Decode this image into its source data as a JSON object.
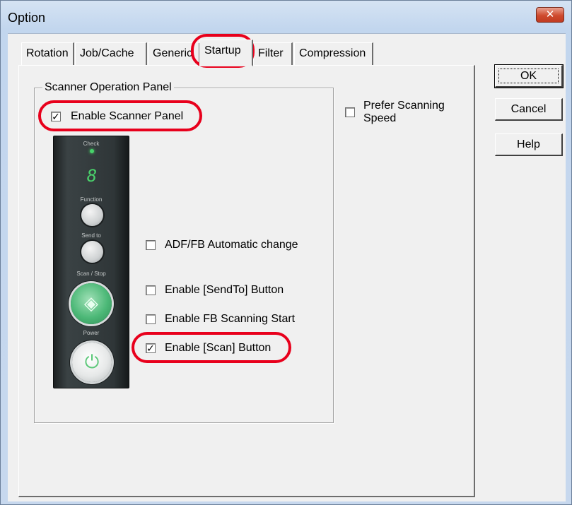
{
  "window": {
    "title": "Option",
    "close_glyph": "✕"
  },
  "tabs": [
    {
      "label": "Rotation"
    },
    {
      "label": "Job/Cache"
    },
    {
      "label": "Generic"
    },
    {
      "label": "Startup",
      "active": true
    },
    {
      "label": "Filter"
    },
    {
      "label": "Compression"
    }
  ],
  "group": {
    "label": "Scanner Operation Panel"
  },
  "checkboxes": {
    "enable_panel": {
      "label": "Enable Scanner Panel",
      "checked": true
    },
    "prefer_speed": {
      "label_line1": "Prefer Scanning",
      "label_line2": "Speed",
      "checked": false
    },
    "adf_fb": {
      "label": "ADF/FB Automatic change",
      "checked": false
    },
    "sendto": {
      "label": "Enable [SendTo] Button",
      "checked": false
    },
    "fb_start": {
      "label": "Enable FB Scanning Start",
      "checked": false
    },
    "scan_btn": {
      "label": "Enable [Scan] Button",
      "checked": true
    }
  },
  "buttons": {
    "ok": "OK",
    "cancel": "Cancel",
    "help": "Help"
  },
  "device": {
    "check": "Check",
    "digit": "8",
    "function": "Function",
    "send_to": "Send to",
    "scan_stop": "Scan / Stop",
    "power": "Power"
  },
  "colors": {
    "highlight": "#e8001c",
    "led": "#47d36a",
    "scan_button": "#4cb877"
  },
  "checkmark": "✓"
}
